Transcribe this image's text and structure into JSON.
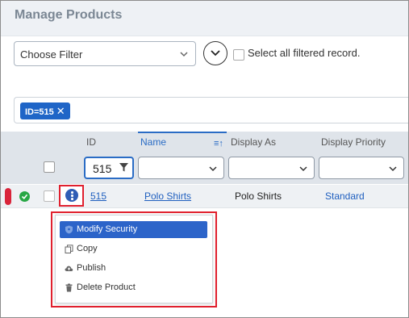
{
  "page": {
    "title": "Manage Products"
  },
  "filter": {
    "placeholder": "Choose Filter",
    "select_all_label": "Select all filtered record."
  },
  "chips": [
    {
      "label": "ID=515",
      "remove": "✕"
    }
  ],
  "table": {
    "columns": {
      "id": "ID",
      "name": "Name",
      "display_as": "Display As",
      "display_priority": "Display Priority"
    },
    "filters": {
      "id_value": "515"
    },
    "rows": [
      {
        "id": "515",
        "name": "Polo Shirts",
        "display_as": "Polo Shirts",
        "display_priority": "Standard"
      }
    ]
  },
  "menu": {
    "items": [
      {
        "label": "Modify Security",
        "icon": "shield-icon",
        "active": true
      },
      {
        "label": "Copy",
        "icon": "copy-icon",
        "active": false
      },
      {
        "label": "Publish",
        "icon": "cloud-upload-icon",
        "active": false
      },
      {
        "label": "Delete Product",
        "icon": "trash-icon",
        "active": false
      }
    ]
  },
  "colors": {
    "accent": "#2c64c9",
    "highlight": "#e0202e",
    "status_ok": "#28a745",
    "marker": "#d9243a"
  }
}
